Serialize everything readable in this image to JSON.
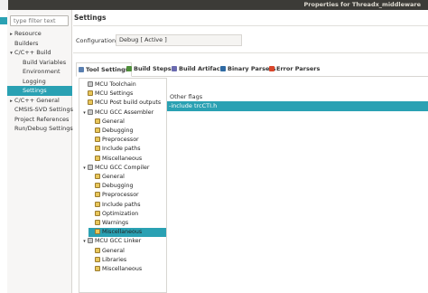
{
  "window": {
    "title": "Properties for Threadx_middleware"
  },
  "filter": {
    "placeholder": "type filter text"
  },
  "nav": {
    "items": [
      {
        "label": "Resource",
        "arrow": "▸"
      },
      {
        "label": "Builders",
        "arrow": ""
      },
      {
        "label": "C/C++ Build",
        "arrow": "▾"
      },
      {
        "label": "Build Variables",
        "arrow": ""
      },
      {
        "label": "Environment",
        "arrow": ""
      },
      {
        "label": "Logging",
        "arrow": ""
      },
      {
        "label": "Settings",
        "arrow": ""
      },
      {
        "label": "C/C++ General",
        "arrow": "▸"
      },
      {
        "label": "CMSIS-SVD Settings",
        "arrow": ""
      },
      {
        "label": "Project References",
        "arrow": ""
      },
      {
        "label": "Run/Debug Settings",
        "arrow": ""
      }
    ]
  },
  "page": {
    "title": "Settings",
    "configuration_label": "Configuration:",
    "configuration_value": "Debug  [ Active ]"
  },
  "tabs": [
    {
      "label": "Tool Settings",
      "icon": "tool-settings-icon",
      "color": "#5a7fb0"
    },
    {
      "label": "Build Steps",
      "icon": "build-steps-icon",
      "color": "#4f8f3a"
    },
    {
      "label": "Build Artifact",
      "icon": "build-artifact-icon",
      "color": "#6b6bb0"
    },
    {
      "label": "Binary Parsers",
      "icon": "binary-parsers-icon",
      "color": "#2f6aa3"
    },
    {
      "label": "Error Parsers",
      "icon": "error-parsers-icon",
      "color": "#d9452a"
    }
  ],
  "tree": [
    {
      "label": "MCU Toolchain",
      "arrow": "",
      "icon": "toolchain-icon"
    },
    {
      "label": "MCU Settings",
      "arrow": "",
      "icon": "settings-icon"
    },
    {
      "label": "MCU Post build outputs",
      "arrow": "",
      "icon": "settings-icon"
    },
    {
      "label": "MCU GCC Assembler",
      "arrow": "▾",
      "icon": "tool-icon"
    },
    {
      "label": "General",
      "arrow": "",
      "icon": "settings-icon"
    },
    {
      "label": "Debugging",
      "arrow": "",
      "icon": "settings-icon"
    },
    {
      "label": "Preprocessor",
      "arrow": "",
      "icon": "settings-icon"
    },
    {
      "label": "Include paths",
      "arrow": "",
      "icon": "settings-icon"
    },
    {
      "label": "Miscellaneous",
      "arrow": "",
      "icon": "settings-icon"
    },
    {
      "label": "MCU GCC Compiler",
      "arrow": "▾",
      "icon": "tool-icon"
    },
    {
      "label": "General",
      "arrow": "",
      "icon": "settings-icon"
    },
    {
      "label": "Debugging",
      "arrow": "",
      "icon": "settings-icon"
    },
    {
      "label": "Preprocessor",
      "arrow": "",
      "icon": "settings-icon"
    },
    {
      "label": "Include paths",
      "arrow": "",
      "icon": "settings-icon"
    },
    {
      "label": "Optimization",
      "arrow": "",
      "icon": "settings-icon"
    },
    {
      "label": "Warnings",
      "arrow": "",
      "icon": "settings-icon"
    },
    {
      "label": "Miscellaneous",
      "arrow": "",
      "icon": "settings-icon"
    },
    {
      "label": "MCU GCC Linker",
      "arrow": "▾",
      "icon": "tool-icon"
    },
    {
      "label": "General",
      "arrow": "",
      "icon": "settings-icon"
    },
    {
      "label": "Libraries",
      "arrow": "",
      "icon": "settings-icon"
    },
    {
      "label": "Miscellaneous",
      "arrow": "",
      "icon": "settings-icon"
    }
  ],
  "options": {
    "flags_label": "Other flags",
    "flags_value": "-include trcCTI.h"
  },
  "colors": {
    "selection": "#2aa1b3",
    "titlebar": "#3c3b37"
  }
}
